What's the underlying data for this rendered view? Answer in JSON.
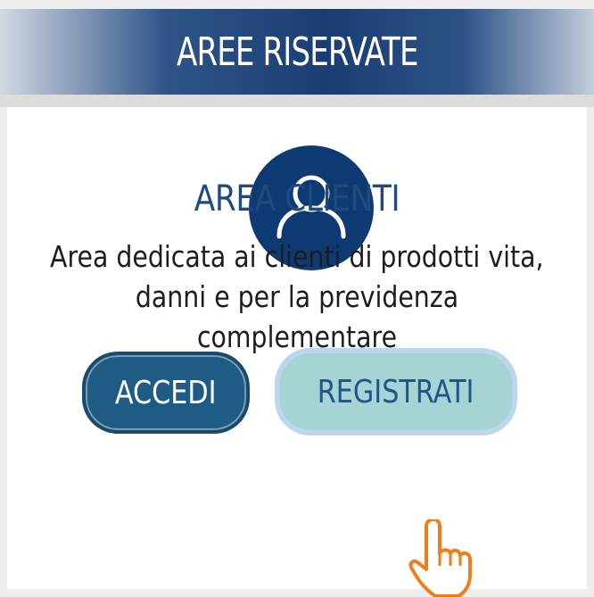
{
  "header": {
    "title": "AREE RISERVATE"
  },
  "client_area": {
    "icon": "user-icon",
    "title": "AREA CLIENTI",
    "description_line1": "Area dedicata ai clienti di prodotti vita,",
    "description_line2": "danni e per la previdenza complementare"
  },
  "buttons": {
    "login_label": "ACCEDI",
    "register_label": "REGISTRATI"
  },
  "cursor": {
    "icon": "hand-pointer-icon"
  },
  "colors": {
    "brand_navy": "#0e3a74",
    "title_blue": "#1f4a7e",
    "login_button": "#1e5c86",
    "register_button": "#a6d3d4",
    "cursor_orange": "#ef7d1a"
  }
}
